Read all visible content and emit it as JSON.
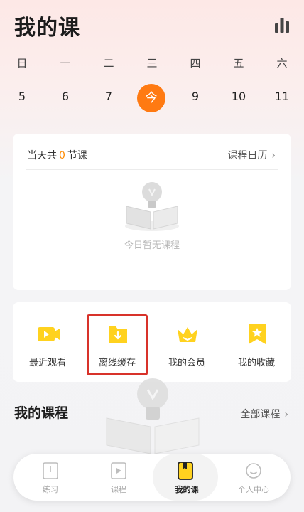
{
  "header": {
    "title": "我的课",
    "stats_icon": "bar-chart-icon"
  },
  "week": {
    "days": [
      "日",
      "一",
      "二",
      "三",
      "四",
      "五",
      "六"
    ],
    "dates": [
      "5",
      "6",
      "7",
      "今",
      "9",
      "10",
      "11"
    ],
    "today_label": "今"
  },
  "today_card": {
    "prefix": "当天共",
    "count": "0",
    "suffix": "节课",
    "calendar_link": "课程日历",
    "empty_text": "今日暂无课程"
  },
  "quick_actions": [
    {
      "label": "最近观看",
      "icon": "play-video-icon"
    },
    {
      "label": "离线缓存",
      "icon": "download-folder-icon"
    },
    {
      "label": "我的会员",
      "icon": "crown-icon"
    },
    {
      "label": "我的收藏",
      "icon": "star-bookmark-icon"
    }
  ],
  "my_courses": {
    "title": "我的课程",
    "all_link": "全部课程"
  },
  "tabbar": {
    "tabs": [
      {
        "label": "练习",
        "icon": "practice-book-icon"
      },
      {
        "label": "课程",
        "icon": "course-play-icon"
      },
      {
        "label": "我的课",
        "icon": "my-course-icon"
      },
      {
        "label": "个人中心",
        "icon": "profile-smile-icon"
      }
    ],
    "active_index": 2
  },
  "colors": {
    "accent_orange": "#ff7a12",
    "highlight_red": "#d8322a",
    "icon_yellow": "#ffd21f"
  }
}
